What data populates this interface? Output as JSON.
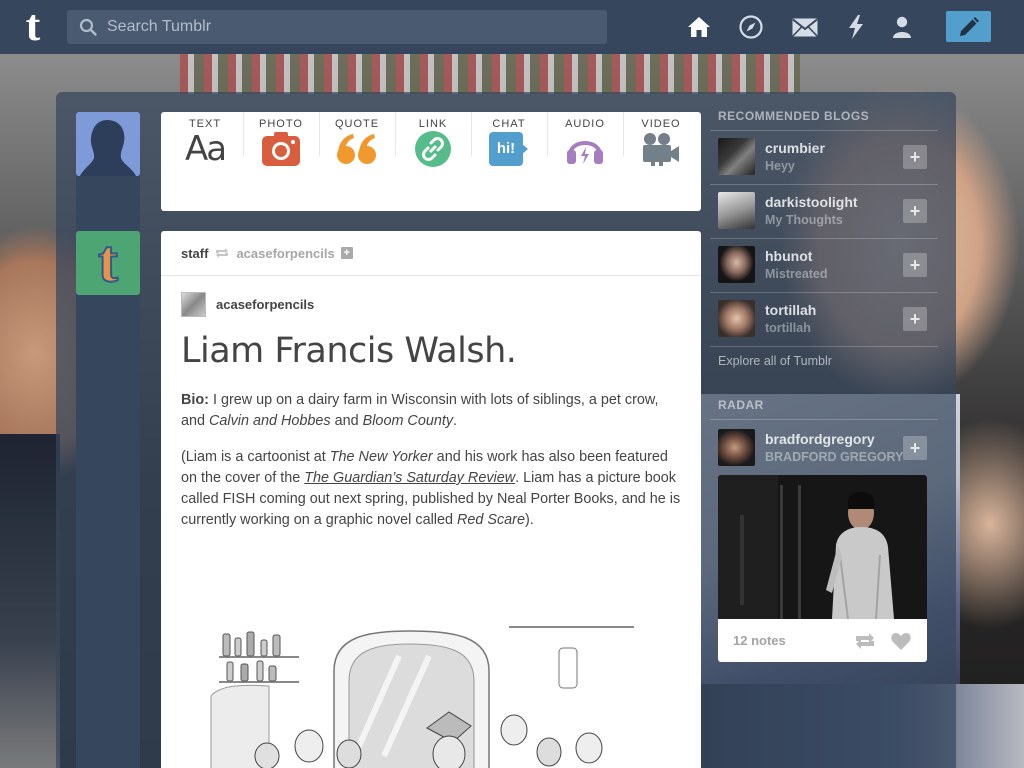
{
  "header": {
    "logo_letter": "t",
    "search_placeholder": "Search Tumblr",
    "nav_icons": [
      "home-icon",
      "explore-compass-icon",
      "inbox-mail-icon",
      "activity-lightning-icon",
      "account-person-icon"
    ],
    "compose_icon": "pencil-icon"
  },
  "colors": {
    "navy": "#36465d",
    "compose_blue": "#529ecc",
    "text_red": "#d95e40",
    "quote_orange": "#f2992e",
    "link_green": "#56bc8a",
    "chat_blue": "#529ecc",
    "audio_purple": "#a77dc2",
    "video_gray": "#748089",
    "staff_avatar_green": "#4ca572"
  },
  "post_types": [
    {
      "label": "TEXT",
      "icon": "text-aa-icon",
      "glyph": "Aa"
    },
    {
      "label": "PHOTO",
      "icon": "camera-icon"
    },
    {
      "label": "QUOTE",
      "icon": "quote-marks-icon",
      "glyph": "66"
    },
    {
      "label": "LINK",
      "icon": "link-chain-icon"
    },
    {
      "label": "CHAT",
      "icon": "chat-bubble-icon",
      "glyph": "hi!"
    },
    {
      "label": "AUDIO",
      "icon": "headphones-icon"
    },
    {
      "label": "VIDEO",
      "icon": "video-camera-icon"
    }
  ],
  "post": {
    "reblogger": "staff",
    "source": "acaseforpencils",
    "author": "acaseforpencils",
    "title": "Liam Francis Walsh.",
    "bio_label": "Bio:",
    "bio_text_1": " I grew up on a dairy farm in Wisconsin with lots of siblings, a pet crow, and ",
    "bio_italic_1": "Calvin and Hobbes",
    "bio_text_2": " and ",
    "bio_italic_2": "Bloom County",
    "bio_text_3": ".",
    "p2_text_1": "(Liam is a cartoonist at ",
    "p2_italic_1": "The New Yorker",
    "p2_text_2": " and his work has also been featured on the cover of the ",
    "p2_link": "The Guardian’s Saturday Review",
    "p2_text_3": ". Liam has a picture book called FISH coming out next spring, published by Neal Porter Books, and he is currently working on a graphic novel called ",
    "p2_italic_2": "Red Scare",
    "p2_text_4": ")."
  },
  "sidebar": {
    "recommended_title": "RECOMMENDED BLOGS",
    "blogs": [
      {
        "name": "crumbier",
        "sub": "Heyy"
      },
      {
        "name": "darkistoolight",
        "sub": "My Thoughts"
      },
      {
        "name": "hbunot",
        "sub": "Mistreated"
      },
      {
        "name": "tortillah",
        "sub": "tortillah"
      }
    ],
    "explore": "Explore all of Tumblr",
    "radar_title": "RADAR",
    "radar": {
      "name": "bradfordgregory",
      "sub": "BRADFORD GREGORY",
      "notes": "12 notes"
    }
  }
}
